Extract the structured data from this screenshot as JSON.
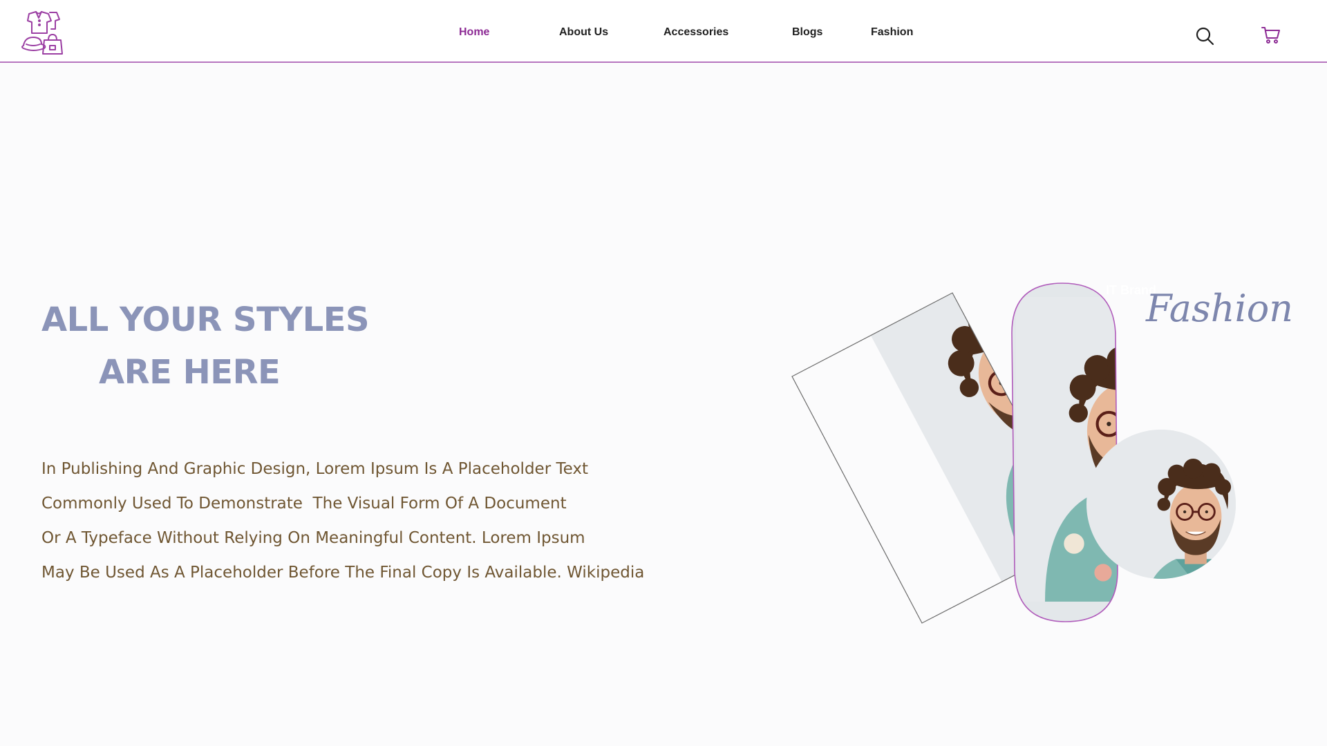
{
  "header": {
    "nav": {
      "home": "Home",
      "about": "About Us",
      "accessories": "Accessories",
      "blogs": "Blogs",
      "fashion": "Fashion"
    },
    "icons": {
      "logo": "clothing-logo-icon",
      "search": "search-icon",
      "cart": "shopping-cart-icon"
    }
  },
  "hero": {
    "title_line1": "ALL YOUR STYLES",
    "title_line2": "ARE HERE",
    "paragraph": [
      "In Publishing And Graphic Design, Lorem Ipsum Is A Placeholder Text",
      "Commonly Used To Demonstrate  The Visual Form Of A Document",
      "Or A Typeface Without Relying On Meaningful Content. Lorem Ipsum",
      "May Be Used As A Placeholder Before The Final Copy Is Available. Wikipedia"
    ]
  },
  "collage": {
    "script_label": "Fashion",
    "ghost_label": "IT Brand"
  },
  "colors": {
    "accent": "#8c2a94",
    "divider": "#b675bf",
    "title": "#8b94b8",
    "body_text": "#6f5632",
    "script": "#7d86ad"
  }
}
